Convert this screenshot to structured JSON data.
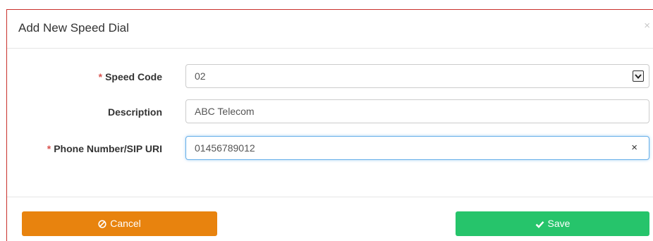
{
  "modal": {
    "title": "Add New Speed Dial",
    "close_glyph": "×"
  },
  "form": {
    "required_mark": "*",
    "speed_code": {
      "label": "Speed Code",
      "value": "02",
      "required": true
    },
    "description": {
      "label": "Description",
      "value": "ABC Telecom",
      "required": false
    },
    "phone": {
      "label": "Phone Number/SIP URI",
      "value": "01456789012",
      "required": true,
      "clear_glyph": "×"
    }
  },
  "buttons": {
    "cancel": {
      "label": "Cancel",
      "icon": "ban-icon",
      "color": "#e8830e"
    },
    "save": {
      "label": "Save",
      "icon": "check-icon",
      "color": "#26c46b"
    }
  }
}
